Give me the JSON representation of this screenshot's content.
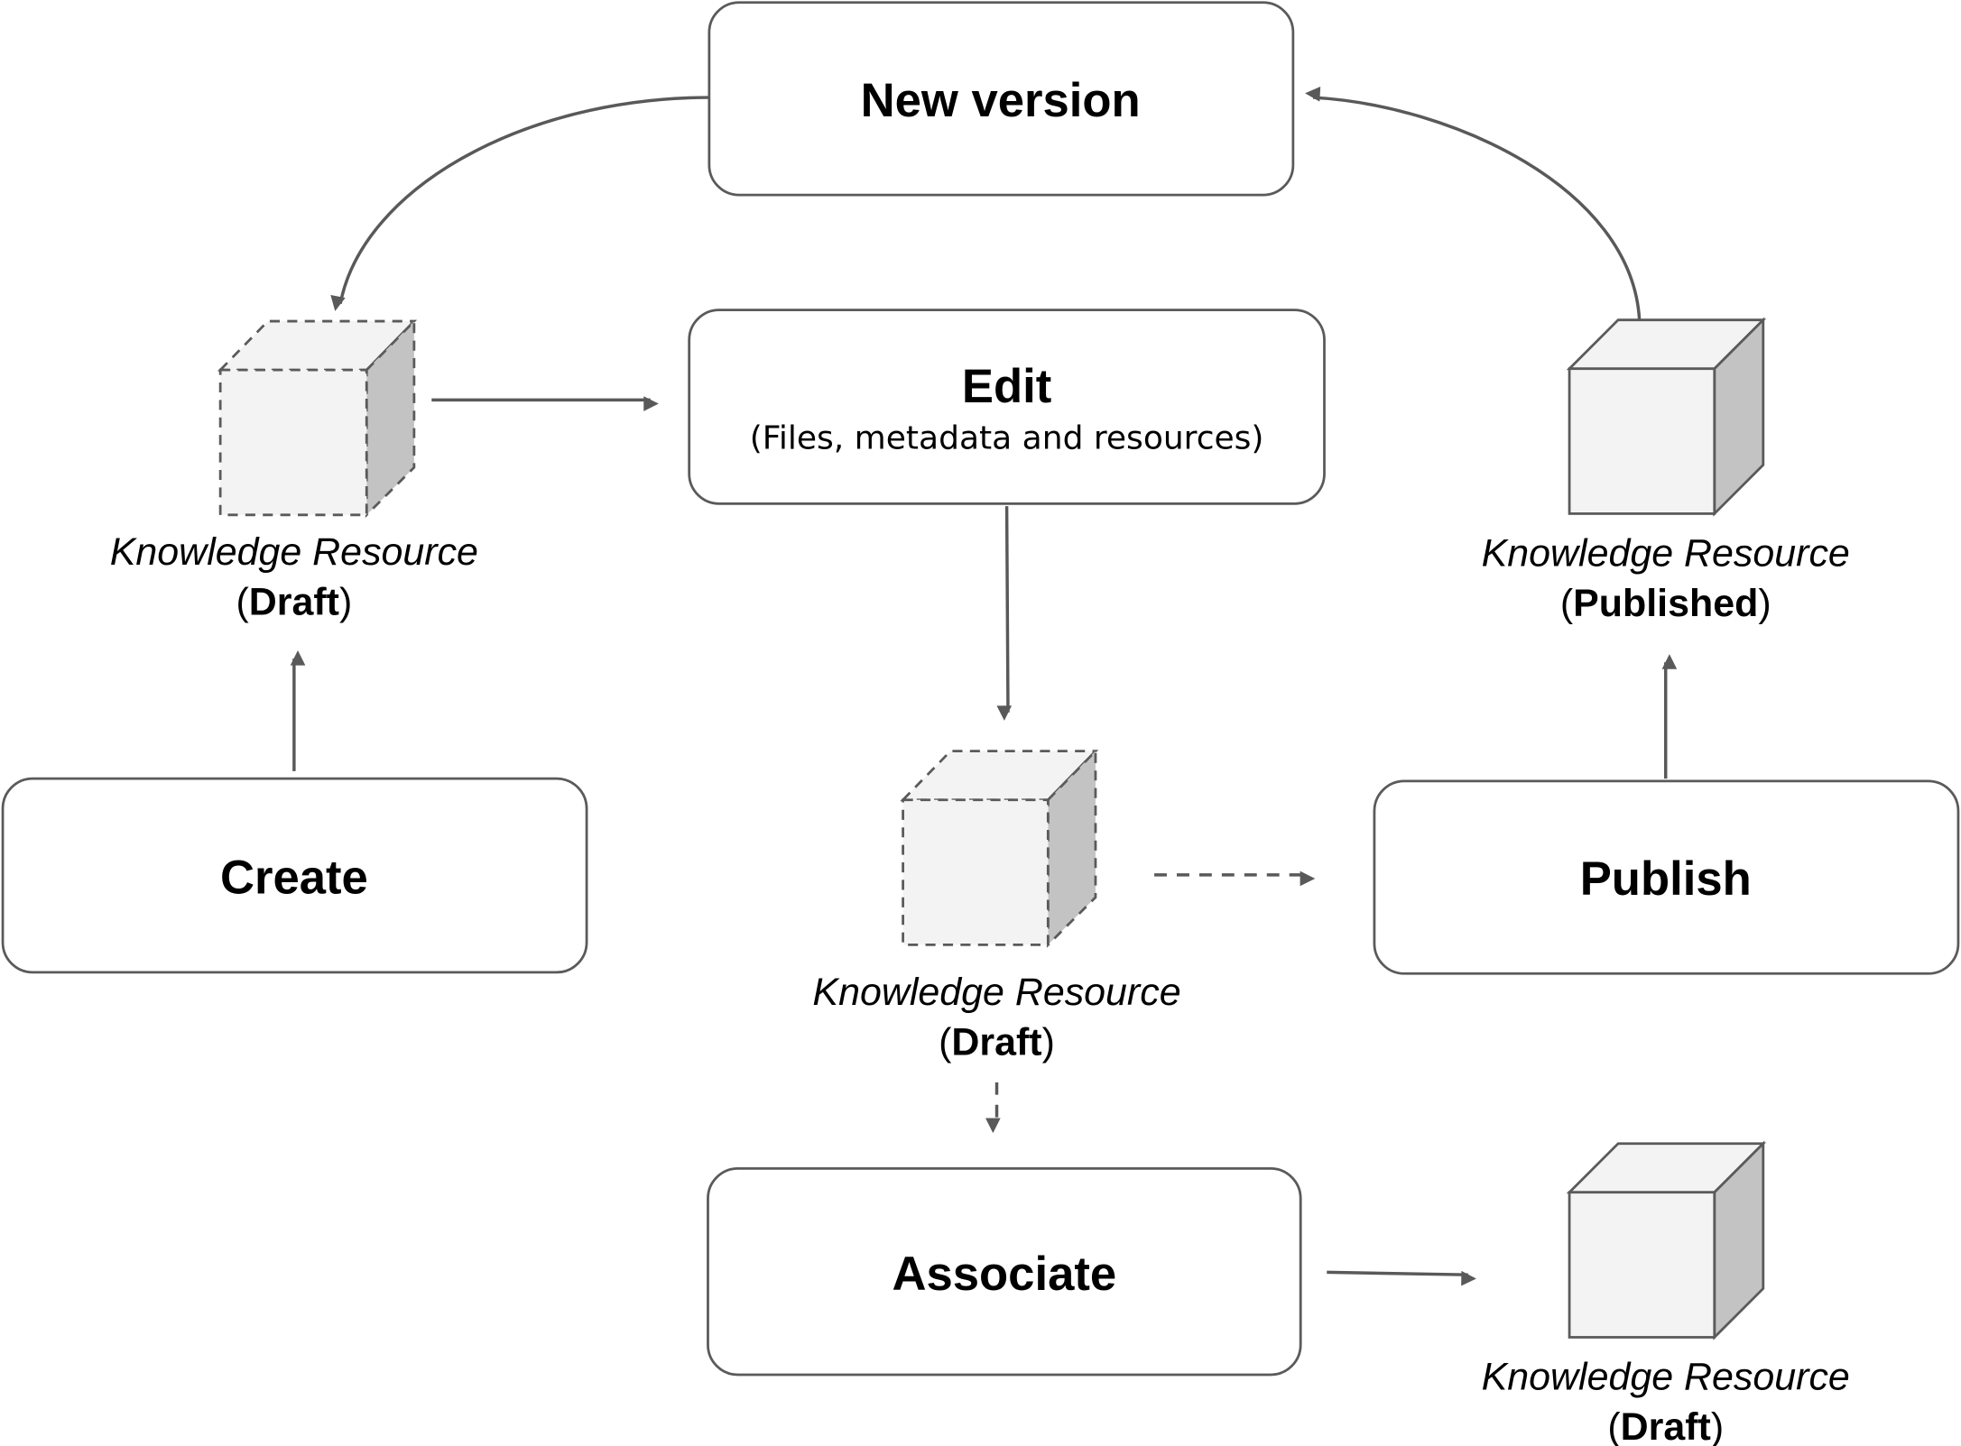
{
  "nodes": {
    "new_version": "New version",
    "edit": "Edit",
    "edit_sub": "(Files, metadata and resources)",
    "create": "Create",
    "publish": "Publish",
    "associate": "Associate"
  },
  "resources": [
    {
      "label": "Knowledge Resource",
      "open": "(",
      "state": "Draft",
      "close": ")",
      "style": "dashed"
    },
    {
      "label": "Knowledge Resource",
      "open": "(",
      "state": "Draft",
      "close": ")",
      "style": "dashed"
    },
    {
      "label": "Knowledge Resource",
      "open": "(",
      "state": "Published",
      "close": ")",
      "style": "solid"
    },
    {
      "label": "Knowledge Resource",
      "open": "(",
      "state": "Draft",
      "close": ")",
      "style": "solid"
    }
  ],
  "colors": {
    "stroke": "#5a5a5a",
    "cube_face": "#f3f3f3",
    "cube_side": "#c3c3c3"
  }
}
